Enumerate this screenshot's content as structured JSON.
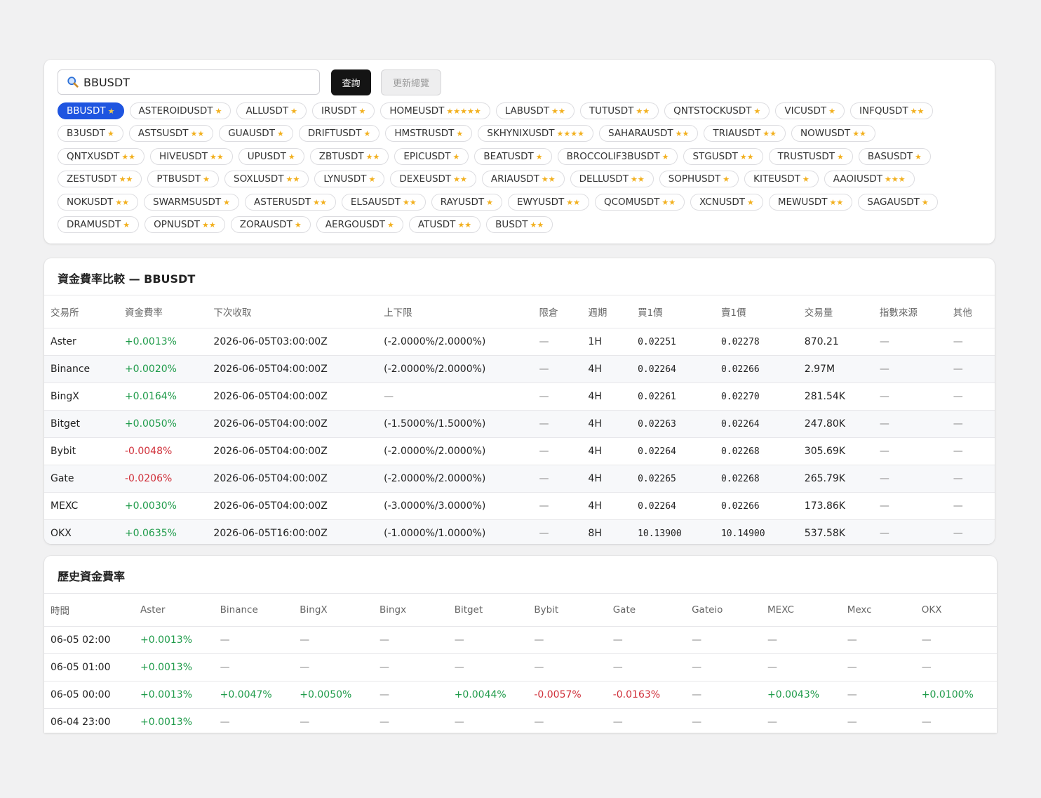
{
  "search": {
    "value": "BBUSDT",
    "query_label": "查詢",
    "refresh_label": "更新總覽"
  },
  "symbols": [
    {
      "name": "BBUSDT",
      "stars": "★",
      "active": true
    },
    {
      "name": "ASTEROIDUSDT",
      "stars": "★"
    },
    {
      "name": "ALLUSDT",
      "stars": "★"
    },
    {
      "name": "IRUSDT",
      "stars": "★"
    },
    {
      "name": "HOMEUSDT",
      "stars": "★★★★★"
    },
    {
      "name": "LABUSDT",
      "stars": "★★"
    },
    {
      "name": "TUTUSDT",
      "stars": "★★"
    },
    {
      "name": "QNTSTOCKUSDT",
      "stars": "★"
    },
    {
      "name": "VICUSDT",
      "stars": "★"
    },
    {
      "name": "INFQUSDT",
      "stars": "★★"
    },
    {
      "name": "B3USDT",
      "stars": "★"
    },
    {
      "name": "ASTSUSDT",
      "stars": "★★"
    },
    {
      "name": "GUAUSDT",
      "stars": "★"
    },
    {
      "name": "DRIFTUSDT",
      "stars": "★"
    },
    {
      "name": "HMSTRUSDT",
      "stars": "★"
    },
    {
      "name": "SKHYNIXUSDT",
      "stars": "★★★★"
    },
    {
      "name": "SAHARAUSDT",
      "stars": "★★"
    },
    {
      "name": "TRIAUSDT",
      "stars": "★★"
    },
    {
      "name": "NOWUSDT",
      "stars": "★★"
    },
    {
      "name": "QNTXUSDT",
      "stars": "★★"
    },
    {
      "name": "HIVEUSDT",
      "stars": "★★"
    },
    {
      "name": "UPUSDT",
      "stars": "★"
    },
    {
      "name": "ZBTUSDT",
      "stars": "★★"
    },
    {
      "name": "EPICUSDT",
      "stars": "★"
    },
    {
      "name": "BEATUSDT",
      "stars": "★"
    },
    {
      "name": "BROCCOLIF3BUSDT",
      "stars": "★"
    },
    {
      "name": "STGUSDT",
      "stars": "★★"
    },
    {
      "name": "TRUSTUSDT",
      "stars": "★"
    },
    {
      "name": "BASUSDT",
      "stars": "★"
    },
    {
      "name": "ZESTUSDT",
      "stars": "★★"
    },
    {
      "name": "PTBUSDT",
      "stars": "★"
    },
    {
      "name": "SOXLUSDT",
      "stars": "★★"
    },
    {
      "name": "LYNUSDT",
      "stars": "★"
    },
    {
      "name": "DEXEUSDT",
      "stars": "★★"
    },
    {
      "name": "ARIAUSDT",
      "stars": "★★"
    },
    {
      "name": "DELLUSDT",
      "stars": "★★"
    },
    {
      "name": "SOPHUSDT",
      "stars": "★"
    },
    {
      "name": "KITEUSDT",
      "stars": "★"
    },
    {
      "name": "AAOIUSDT",
      "stars": "★★★"
    },
    {
      "name": "NOKUSDT",
      "stars": "★★"
    },
    {
      "name": "SWARMSUSDT",
      "stars": "★"
    },
    {
      "name": "ASTERUSDT",
      "stars": "★★"
    },
    {
      "name": "ELSAUSDT",
      "stars": "★★"
    },
    {
      "name": "RAYUSDT",
      "stars": "★"
    },
    {
      "name": "EWYUSDT",
      "stars": "★★"
    },
    {
      "name": "QCOMUSDT",
      "stars": "★★"
    },
    {
      "name": "XCNUSDT",
      "stars": "★"
    },
    {
      "name": "MEWUSDT",
      "stars": "★★"
    },
    {
      "name": "SAGAUSDT",
      "stars": "★"
    },
    {
      "name": "DRAMUSDT",
      "stars": "★"
    },
    {
      "name": "OPNUSDT",
      "stars": "★★"
    },
    {
      "name": "ZORAUSDT",
      "stars": "★"
    },
    {
      "name": "AERGOUSDT",
      "stars": "★"
    },
    {
      "name": "ATUSDT",
      "stars": "★★"
    },
    {
      "name": "BUSDT",
      "stars": "★★"
    }
  ],
  "rates": {
    "title": "資金費率比較 — BBUSDT",
    "columns": [
      "交易所",
      "資金費率",
      "下次收取",
      "上下限",
      "限倉",
      "週期",
      "買1價",
      "賣1價",
      "交易量",
      "指數來源",
      "其他"
    ],
    "rows": [
      [
        "Aster",
        "+0.0013%",
        "2026-06-05T03:00:00Z",
        "(-2.0000%/2.0000%)",
        "—",
        "1H",
        "0.02251",
        "0.02278",
        "870.21",
        "—",
        "—"
      ],
      [
        "Binance",
        "+0.0020%",
        "2026-06-05T04:00:00Z",
        "(-2.0000%/2.0000%)",
        "—",
        "4H",
        "0.02264",
        "0.02266",
        "2.97M",
        "—",
        "—"
      ],
      [
        "BingX",
        "+0.0164%",
        "2026-06-05T04:00:00Z",
        "—",
        "—",
        "4H",
        "0.02261",
        "0.02270",
        "281.54K",
        "—",
        "—"
      ],
      [
        "Bitget",
        "+0.0050%",
        "2026-06-05T04:00:00Z",
        "(-1.5000%/1.5000%)",
        "—",
        "4H",
        "0.02263",
        "0.02264",
        "247.80K",
        "—",
        "—"
      ],
      [
        "Bybit",
        "-0.0048%",
        "2026-06-05T04:00:00Z",
        "(-2.0000%/2.0000%)",
        "—",
        "4H",
        "0.02264",
        "0.02268",
        "305.69K",
        "—",
        "—"
      ],
      [
        "Gate",
        "-0.0206%",
        "2026-06-05T04:00:00Z",
        "(-2.0000%/2.0000%)",
        "—",
        "4H",
        "0.02265",
        "0.02268",
        "265.79K",
        "—",
        "—"
      ],
      [
        "MEXC",
        "+0.0030%",
        "2026-06-05T04:00:00Z",
        "(-3.0000%/3.0000%)",
        "—",
        "4H",
        "0.02264",
        "0.02266",
        "173.86K",
        "—",
        "—"
      ],
      [
        "OKX",
        "+0.0635%",
        "2026-06-05T16:00:00Z",
        "(-1.0000%/1.0000%)",
        "—",
        "8H",
        "10.13900",
        "10.14900",
        "537.58K",
        "—",
        "—"
      ]
    ]
  },
  "history": {
    "title": "歷史資金費率",
    "columns": [
      "時間",
      "Aster",
      "Binance",
      "BingX",
      "Bingx",
      "Bitget",
      "Bybit",
      "Gate",
      "Gateio",
      "MEXC",
      "Mexc",
      "OKX"
    ],
    "rows": [
      [
        "06-05 02:00",
        "+0.0013%",
        "—",
        "—",
        "—",
        "—",
        "—",
        "—",
        "—",
        "—",
        "—",
        "—"
      ],
      [
        "06-05 01:00",
        "+0.0013%",
        "—",
        "—",
        "—",
        "—",
        "—",
        "—",
        "—",
        "—",
        "—",
        "—"
      ],
      [
        "06-05 00:00",
        "+0.0013%",
        "+0.0047%",
        "+0.0050%",
        "—",
        "+0.0044%",
        "-0.0057%",
        "-0.0163%",
        "—",
        "+0.0043%",
        "—",
        "+0.0100%"
      ],
      [
        "06-04 23:00",
        "+0.0013%",
        "—",
        "—",
        "—",
        "—",
        "—",
        "—",
        "—",
        "—",
        "—",
        "—"
      ]
    ]
  },
  "colors": {
    "positive": "#1f9b4a",
    "negative": "#d0303a",
    "active_chip": "#1f55e0",
    "star": "#f2b01e"
  }
}
